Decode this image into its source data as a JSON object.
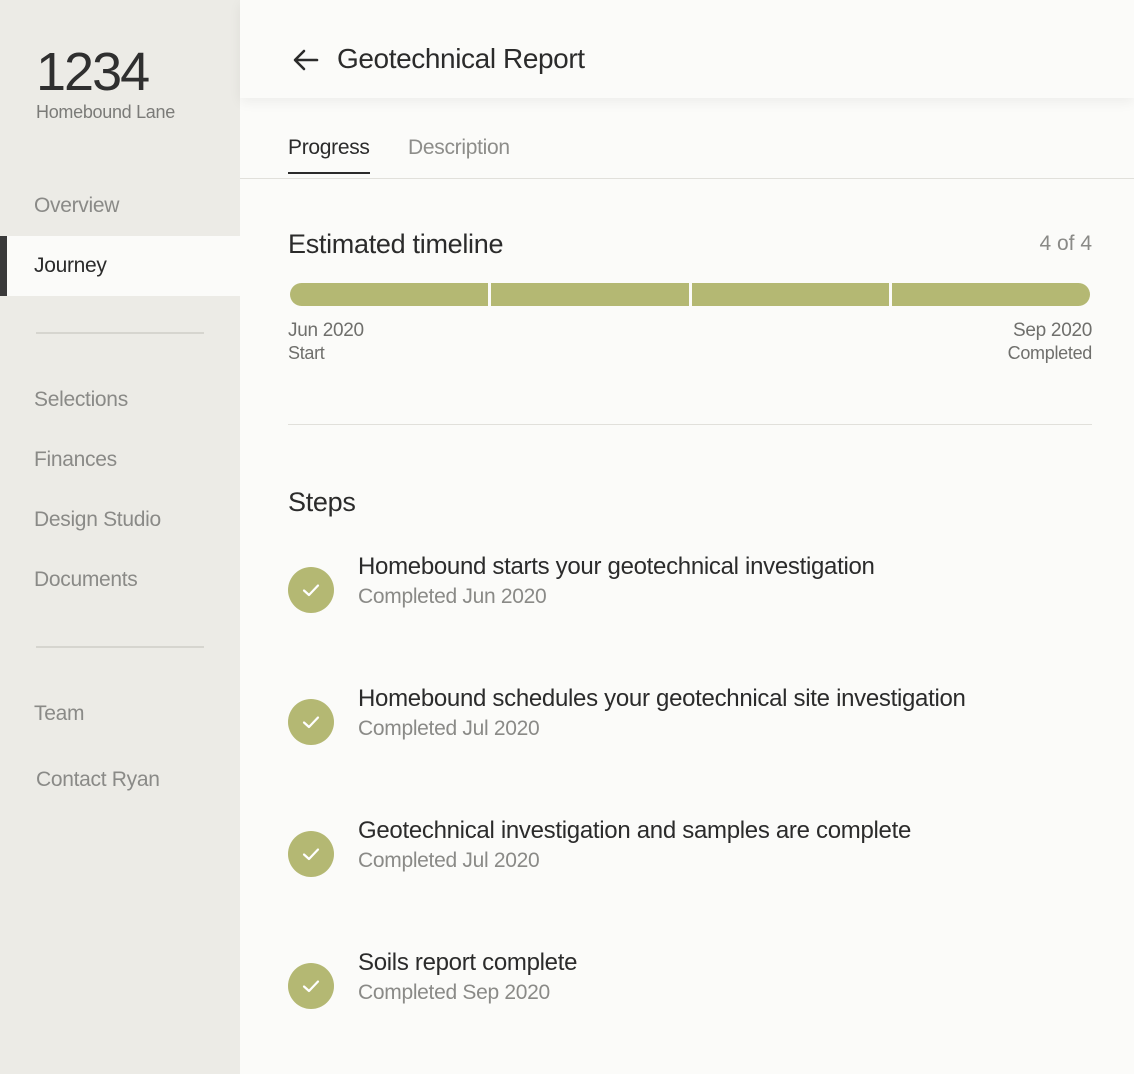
{
  "sidebar": {
    "address_number": "1234",
    "address_street": "Homebound Lane",
    "nav_primary": [
      {
        "label": "Overview",
        "active": false
      },
      {
        "label": "Journey",
        "active": true
      }
    ],
    "nav_secondary": [
      {
        "label": "Selections"
      },
      {
        "label": "Finances"
      },
      {
        "label": "Design Studio"
      },
      {
        "label": "Documents"
      }
    ],
    "nav_tertiary": [
      {
        "label": "Team"
      },
      {
        "label": "Contact Ryan"
      }
    ]
  },
  "header": {
    "back_icon": "arrow-left-icon",
    "title": "Geotechnical Report"
  },
  "tabs": [
    {
      "label": "Progress",
      "active": true
    },
    {
      "label": "Description",
      "active": false
    }
  ],
  "timeline": {
    "title": "Estimated timeline",
    "count": "4 of 4",
    "completed_segments": 4,
    "total_segments": 4,
    "start_date": "Jun 2020",
    "start_label": "Start",
    "end_date": "Sep 2020",
    "end_label": "Completed"
  },
  "steps": {
    "title": "Steps",
    "items": [
      {
        "title": "Homebound starts your geotechnical investigation",
        "status": "Completed Jun 2020"
      },
      {
        "title": "Homebound schedules your geotechnical site investigation",
        "status": "Completed Jul 2020"
      },
      {
        "title": "Geotechnical investigation and samples are complete",
        "status": "Completed Jul 2020"
      },
      {
        "title": "Soils report complete",
        "status": "Completed Sep 2020"
      }
    ]
  },
  "colors": {
    "accent": "#b4b873",
    "sidebar_bg": "#ecebe6",
    "page_bg": "#fbfbf9"
  }
}
